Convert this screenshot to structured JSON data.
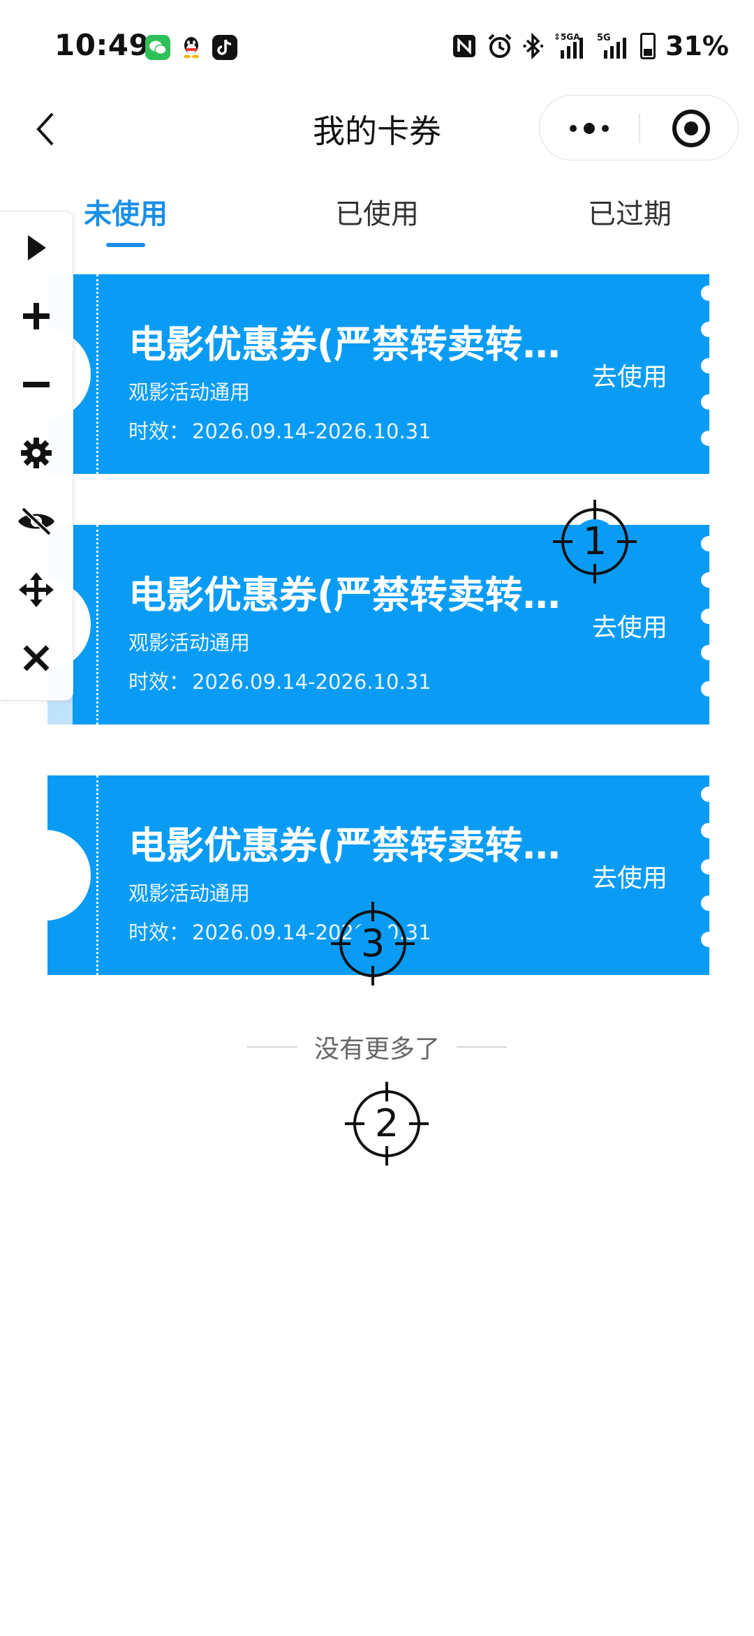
{
  "status_bar": {
    "time": "10:49",
    "battery": "31%",
    "network_1": "5GA",
    "network_2": "5G",
    "icons": [
      "wechat-icon",
      "qq-icon",
      "douyin-icon",
      "nfc-icon",
      "alarm-icon",
      "bluetooth-icon"
    ]
  },
  "nav": {
    "title": "我的卡券"
  },
  "tabs": [
    {
      "label": "未使用",
      "active": true
    },
    {
      "label": "已使用",
      "active": false
    },
    {
      "label": "已过期",
      "active": false
    }
  ],
  "coupons": [
    {
      "title": "电影优惠券(严禁转卖转…",
      "desc": "观影活动通用",
      "validity_label": "时效：",
      "validity": "2026.09.14-2026.10.31",
      "action": "去使用"
    },
    {
      "title": "电影优惠券(严禁转卖转…",
      "desc": "观影活动通用",
      "validity_label": "时效：",
      "validity": "2026.09.14-2026.10.31",
      "action": "去使用"
    },
    {
      "title": "电影优惠券(严禁转卖转…",
      "desc": "观影活动通用",
      "validity_label": "时效：",
      "validity": "2026.09.14-2026.10.31",
      "action": "去使用"
    }
  ],
  "footer": {
    "no_more": "没有更多了"
  },
  "toolbar": {
    "items": [
      "play-icon",
      "plus-icon",
      "minus-icon",
      "settings-icon",
      "eye-off-icon",
      "move-icon",
      "close-icon"
    ]
  },
  "markers": [
    {
      "label": "1"
    },
    {
      "label": "2"
    },
    {
      "label": "3"
    }
  ],
  "colors": {
    "accent": "#1a8fe8",
    "coupon": "#0a9cf5"
  }
}
